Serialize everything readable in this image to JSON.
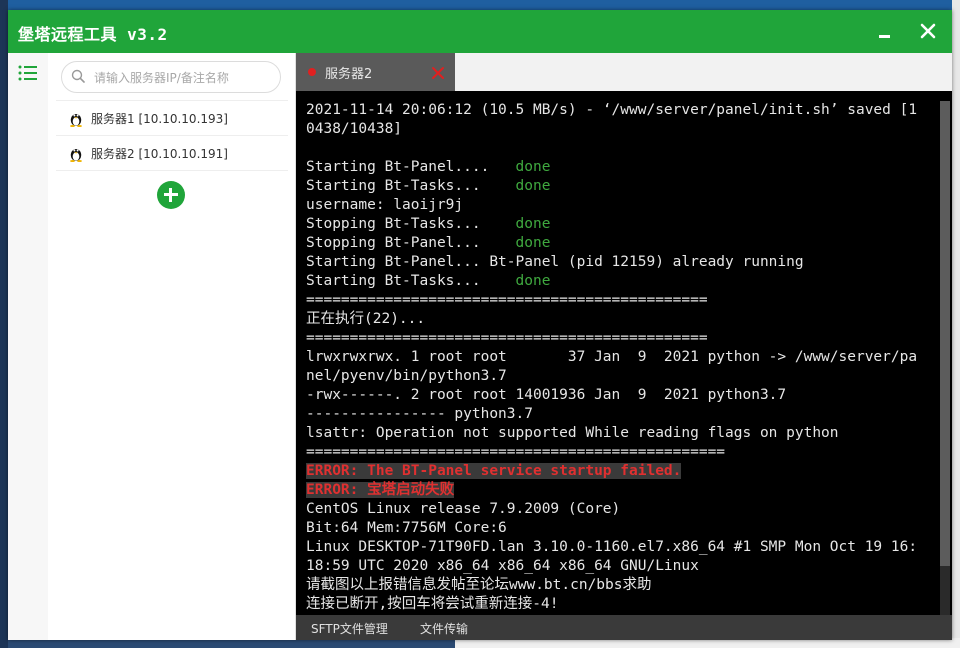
{
  "window": {
    "title": "堡塔远程工具 v3.2"
  },
  "search": {
    "placeholder": "请输入服务器IP/备注名称",
    "value": ""
  },
  "servers": [
    {
      "label": "服务器1 [10.10.10.193]"
    },
    {
      "label": "服务器2 [10.10.10.191]"
    }
  ],
  "tab": {
    "label": "服务器2"
  },
  "terminal": {
    "lines": [
      {
        "t": "2021-11-14 20:06:12 (10.5 MB/s) - ‘/www/server/panel/init.sh’ saved [1"
      },
      {
        "t": "0438/10438]"
      },
      {
        "t": ""
      },
      {
        "t": "Starting Bt-Panel....   ",
        "g": "done"
      },
      {
        "t": "Starting Bt-Tasks...    ",
        "g": "done"
      },
      {
        "t": "username: laoijr9j"
      },
      {
        "t": "Stopping Bt-Tasks...    ",
        "g": "done"
      },
      {
        "t": "Stopping Bt-Panel...    ",
        "g": "done"
      },
      {
        "t": "Starting Bt-Panel... Bt-Panel (pid 12159) already running"
      },
      {
        "t": "Starting Bt-Tasks...    ",
        "g": "done"
      },
      {
        "t": "=============================================="
      },
      {
        "t": "正在执行(22)..."
      },
      {
        "t": "=============================================="
      },
      {
        "t": "lrwxrwxrwx. 1 root root       37 Jan  9  2021 python -> /www/server/pa"
      },
      {
        "t": "nel/pyenv/bin/python3.7"
      },
      {
        "t": "-rwx------. 2 root root 14001936 Jan  9  2021 python3.7"
      },
      {
        "t": "---------------- python3.7"
      },
      {
        "t": "lsattr: Operation not supported While reading flags on python"
      },
      {
        "t": "================================================"
      },
      {
        "t": "ERROR: The BT-Panel service startup failed.",
        "e": true
      },
      {
        "t": "ERROR: 宝塔启动失败",
        "e": true
      },
      {
        "t": "CentOS Linux release 7.9.2009 (Core)"
      },
      {
        "t": "Bit:64 Mem:7756M Core:6"
      },
      {
        "t": "Linux DESKTOP-71T90FD.lan 3.10.0-1160.el7.x86_64 #1 SMP Mon Oct 19 16:"
      },
      {
        "t": "18:59 UTC 2020 x86_64 x86_64 x86_64 GNU/Linux"
      },
      {
        "t": "请截图以上报错信息发帖至论坛www.bt.cn/bbs求助"
      },
      {
        "t": "连接已断开,按回车将尝试重新连接-4!"
      }
    ]
  },
  "bottom": {
    "sftp": "SFTP文件管理",
    "transfer": "文件传输"
  },
  "colors": {
    "brand": "#20a53a",
    "error": "#e03030",
    "done": "#3fa93f"
  }
}
